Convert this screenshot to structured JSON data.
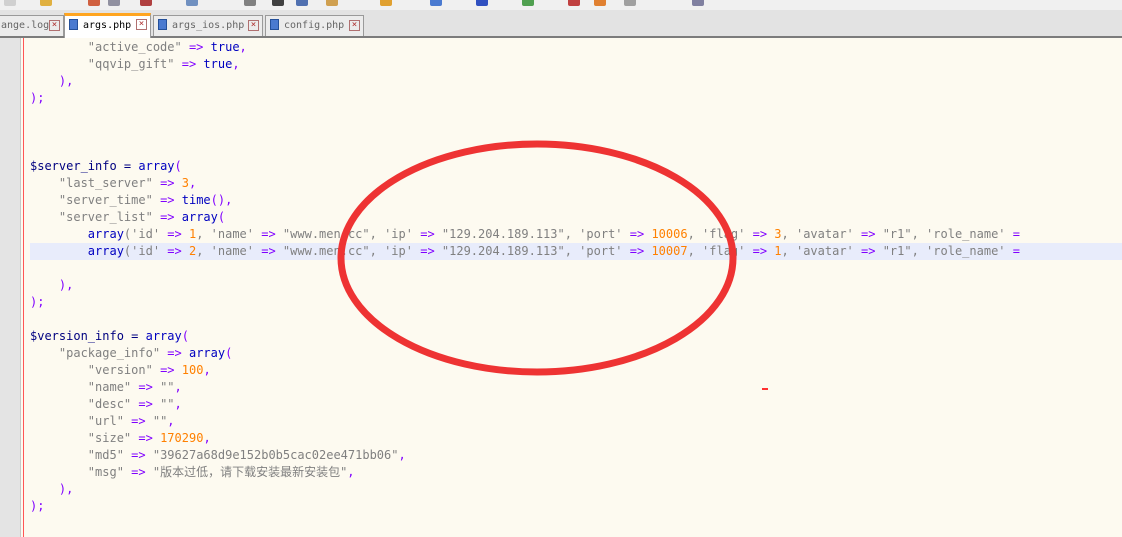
{
  "tabs": [
    {
      "label": "ange.log",
      "active": false
    },
    {
      "label": "args.php",
      "active": true
    },
    {
      "label": "args_ios.php",
      "active": false
    },
    {
      "label": "config.php",
      "active": false
    }
  ],
  "code": {
    "l1": {
      "key": "\"active_code\"",
      "arrow": "=>",
      "val": "true",
      "end": ","
    },
    "l2": {
      "key": "\"qqvip_gift\"",
      "arrow": "=>",
      "val": "true",
      "end": ","
    },
    "l3": {
      "text": "),"
    },
    "l4": {
      "text": ");"
    },
    "l5": {
      "var": "$server_info",
      "eq": " = ",
      "fn": "array",
      "paren": "("
    },
    "l6": {
      "key": "\"last_server\"",
      "arrow": "=>",
      "num": "3",
      "end": ","
    },
    "l7": {
      "key": "\"server_time\"",
      "arrow": "=>",
      "fn": "time",
      "end": "(),"
    },
    "l8": {
      "key": "\"server_list\"",
      "arrow": "=>",
      "fn": "array",
      "end": "("
    },
    "l9": {
      "fn": "array",
      "p1": "('id'",
      "a1": "=>",
      "n1": "1",
      "p2": ", 'name'",
      "a2": "=>",
      "s1": "\"www.men.cc\"",
      "p3": ", 'ip'",
      "a3": "=>",
      "s2": "\"129.204.189.113\"",
      "p4": ", 'port'",
      "a4": "=>",
      "n2": "10006",
      "p5": ", 'flag'",
      "a5": "=>",
      "n3": "3",
      "p6": ", 'avatar'",
      "a6": "=>",
      "s3": "\"r1\"",
      "p7": ", 'role_name'",
      "a7": "="
    },
    "l10": {
      "fn": "array",
      "p1": "('id'",
      "a1": "=>",
      "n1": "2",
      "p2": ", 'name'",
      "a2": "=>",
      "s1": "\"www.men.cc\"",
      "p3": ", 'ip'",
      "a3": "=>",
      "s2": "\"129.204.189.113\"",
      "p4": ", 'port'",
      "a4": "=>",
      "n2": "10007",
      "p5": ", 'flag'",
      "a5": "=>",
      "n3": "1",
      "p6": ", 'avatar'",
      "a6": "=>",
      "s3": "\"r1\"",
      "p7": ", 'role_name'",
      "a7": "="
    },
    "l11": {
      "text": "),"
    },
    "l12": {
      "text": ");"
    },
    "l13": {
      "var": "$version_info",
      "eq": " = ",
      "fn": "array",
      "paren": "("
    },
    "l14": {
      "key": "\"package_info\"",
      "arrow": "=>",
      "fn": "array",
      "end": "("
    },
    "l15": {
      "key": "\"version\"",
      "arrow": "=>",
      "num": "100",
      "end": ","
    },
    "l16": {
      "key": "\"name\"",
      "arrow": "=>",
      "val": "\"\"",
      "end": ","
    },
    "l17": {
      "key": "\"desc\"",
      "arrow": "=>",
      "val": "\"\"",
      "end": ","
    },
    "l18": {
      "key": "\"url\"",
      "arrow": "=>",
      "val": "\"\"",
      "end": ","
    },
    "l19": {
      "key": "\"size\"",
      "arrow": "=>",
      "num": "170290",
      "end": ","
    },
    "l20": {
      "key": "\"md5\"",
      "arrow": "=>",
      "val": "\"39627a68d9e152b0b5cac02ee471bb06\"",
      "end": ","
    },
    "l21": {
      "key": "\"msg\"",
      "arrow": "=>",
      "val": "\"版本过低，请下载安装最新安装包\"",
      "end": ","
    },
    "l22": {
      "text": "),"
    },
    "l23": {
      "text": ");"
    }
  },
  "colors": {
    "annotation_ellipse": "#ee3333",
    "active_tab_accent": "#ffa520",
    "keyword": "#0000c0",
    "number": "#ff8000",
    "operator": "#8000ff"
  }
}
